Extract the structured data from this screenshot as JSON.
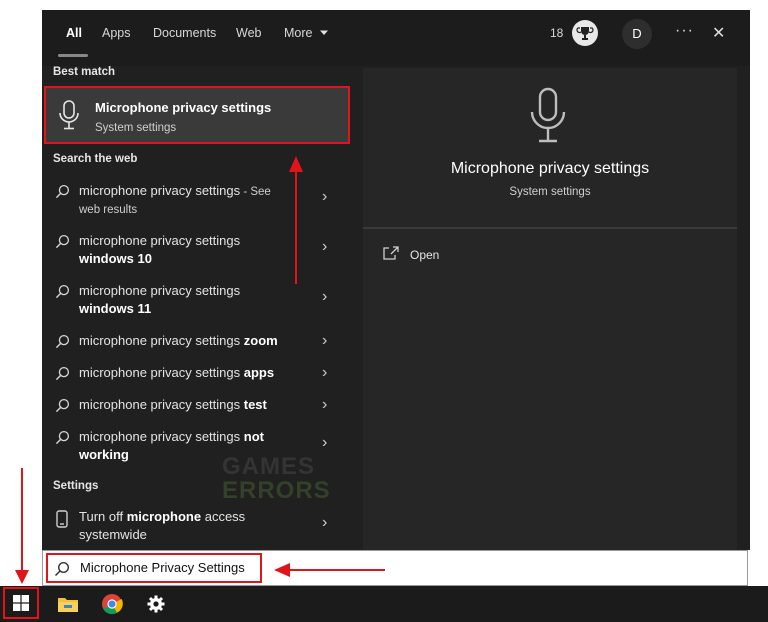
{
  "tabs": [
    {
      "label": "All"
    },
    {
      "label": "Apps"
    },
    {
      "label": "Documents"
    },
    {
      "label": "Web"
    },
    {
      "label": "More"
    }
  ],
  "topbar": {
    "points": "18",
    "avatar": "D",
    "more_dots": "···",
    "close": "✕"
  },
  "best_match": {
    "header": "Best match",
    "title": "Microphone privacy settings",
    "subtitle": "System settings"
  },
  "web": {
    "header": "Search the web",
    "items": [
      {
        "pre": "microphone privacy settings",
        "bold": "",
        "post": " - See",
        "line2": "web results",
        "line2_bold": ""
      },
      {
        "pre": "microphone privacy settings",
        "bold": "",
        "post": "",
        "line2": "",
        "line2_bold": "windows 10"
      },
      {
        "pre": "microphone privacy settings",
        "bold": "",
        "post": "",
        "line2": "",
        "line2_bold": "windows 11"
      },
      {
        "pre": "microphone privacy settings ",
        "bold": "zoom",
        "post": "",
        "line2": "",
        "line2_bold": ""
      },
      {
        "pre": "microphone privacy settings ",
        "bold": "apps",
        "post": "",
        "line2": "",
        "line2_bold": ""
      },
      {
        "pre": "microphone privacy settings ",
        "bold": "test",
        "post": "",
        "line2": "",
        "line2_bold": ""
      },
      {
        "pre": "microphone privacy settings ",
        "bold": "not",
        "post": "",
        "line2": "",
        "line2_bold": "working"
      }
    ]
  },
  "settings": {
    "header": "Settings",
    "item": {
      "pre": "Turn off ",
      "bold": "microphone",
      "post": " access",
      "line2": "systemwide"
    }
  },
  "preview": {
    "title": "Microphone privacy settings",
    "subtitle": "System settings",
    "open_label": "Open"
  },
  "watermark": {
    "line1": "GAMES",
    "line2": "ERRORS"
  },
  "search": {
    "value": "Microphone Privacy Settings"
  },
  "colors": {
    "highlight": "#e0141b",
    "panel": "#202020",
    "preview": "#262626"
  }
}
